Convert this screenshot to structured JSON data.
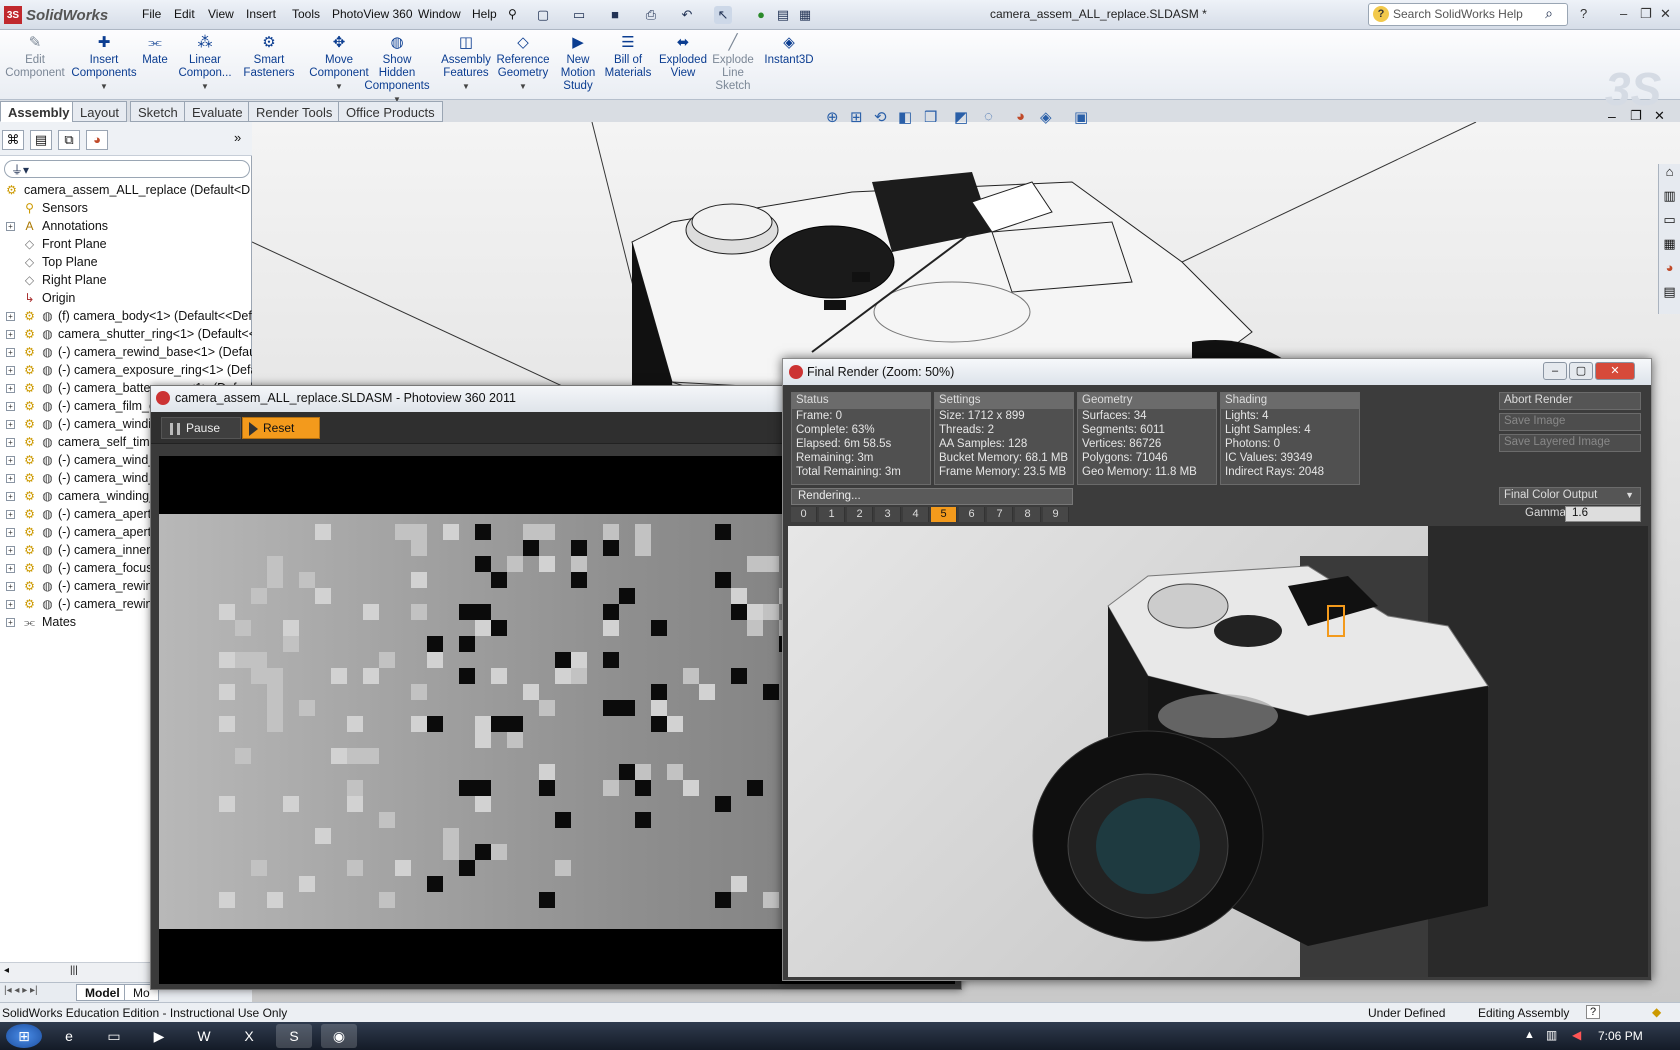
{
  "app": {
    "logo_text": "SolidWorks",
    "doc_title": "camera_assem_ALL_replace.SLDASM *",
    "help_search_placeholder": "Search SolidWorks Help"
  },
  "menu": [
    "File",
    "Edit",
    "View",
    "Insert",
    "Tools",
    "PhotoView 360",
    "Window",
    "Help"
  ],
  "commands": [
    {
      "label": "Edit\nComponent",
      "icon": "edit-component-icon",
      "disabled": true
    },
    {
      "label": "Insert\nComponents",
      "icon": "insert-components-icon"
    },
    {
      "label": "Mate",
      "icon": "mate-icon"
    },
    {
      "label": "Linear\nCompon...",
      "icon": "linear-pattern-icon"
    },
    {
      "label": "Smart\nFasteners",
      "icon": "smart-fasteners-icon"
    },
    {
      "label": "Move\nComponent",
      "icon": "move-component-icon"
    },
    {
      "label": "Show\nHidden\nComponents",
      "icon": "show-hidden-icon"
    },
    {
      "label": "Assembly\nFeatures",
      "icon": "assembly-features-icon"
    },
    {
      "label": "Reference\nGeometry",
      "icon": "reference-geometry-icon"
    },
    {
      "label": "New\nMotion\nStudy",
      "icon": "motion-study-icon"
    },
    {
      "label": "Bill of\nMaterials",
      "icon": "bom-icon"
    },
    {
      "label": "Exploded\nView",
      "icon": "exploded-view-icon"
    },
    {
      "label": "Explode\nLine\nSketch",
      "icon": "explode-line-icon",
      "disabled": true
    },
    {
      "label": "Instant3D",
      "icon": "instant3d-icon"
    }
  ],
  "tabs": [
    "Assembly",
    "Layout",
    "Sketch",
    "Evaluate",
    "Render Tools",
    "Office Products"
  ],
  "tree": [
    {
      "label": "camera_assem_ALL_replace  (Default<D",
      "icon": "assembly-icon",
      "level": 0
    },
    {
      "label": "Sensors",
      "icon": "sensors-icon",
      "level": 1
    },
    {
      "label": "Annotations",
      "icon": "annotations-icon",
      "level": 1,
      "expand": true
    },
    {
      "label": "Front Plane",
      "icon": "plane-icon",
      "level": 1
    },
    {
      "label": "Top Plane",
      "icon": "plane-icon",
      "level": 1
    },
    {
      "label": "Right Plane",
      "icon": "plane-icon",
      "level": 1
    },
    {
      "label": "Origin",
      "icon": "origin-icon",
      "level": 1
    },
    {
      "label": "(f) camera_body<1> (Default<<Defa",
      "icon": "part-icon",
      "level": 1,
      "expand": true
    },
    {
      "label": "camera_shutter_ring<1> (Default<<",
      "icon": "part-icon",
      "level": 1,
      "expand": true
    },
    {
      "label": "(-) camera_rewind_base<1> (Default",
      "icon": "part-icon",
      "level": 1,
      "expand": true
    },
    {
      "label": "(-) camera_exposure_ring<1> (Defau",
      "icon": "part-icon",
      "level": 1,
      "expand": true
    },
    {
      "label": "(-) camera_battery_cap<1> (Default",
      "icon": "part-icon",
      "level": 1,
      "expand": true
    },
    {
      "label": "(-) camera_film_c",
      "icon": "part-icon",
      "level": 1,
      "expand": true
    },
    {
      "label": "(-) camera_windi",
      "icon": "part-icon",
      "level": 1,
      "expand": true
    },
    {
      "label": "camera_self_time",
      "icon": "part-icon",
      "level": 1,
      "expand": true
    },
    {
      "label": "(-) camera_wind_",
      "icon": "part-icon",
      "level": 1,
      "expand": true
    },
    {
      "label": "(-) camera_wind_",
      "icon": "part-icon",
      "level": 1,
      "expand": true
    },
    {
      "label": "camera_winding_",
      "icon": "part-icon",
      "level": 1,
      "expand": true
    },
    {
      "label": "(-) camera_apert",
      "icon": "part-icon",
      "level": 1,
      "expand": true
    },
    {
      "label": "(-) camera_apert",
      "icon": "part-icon",
      "level": 1,
      "expand": true
    },
    {
      "label": "(-) camera_inner_",
      "icon": "part-icon",
      "level": 1,
      "expand": true
    },
    {
      "label": "(-) camera_focus_",
      "icon": "part-icon",
      "level": 1,
      "expand": true
    },
    {
      "label": "(-) camera_rewin",
      "icon": "part-icon",
      "level": 1,
      "expand": true
    },
    {
      "label": "(-) camera_rewin",
      "icon": "part-icon",
      "level": 1,
      "expand": true
    },
    {
      "label": "Mates",
      "icon": "mates-icon",
      "level": 1,
      "expand": true
    }
  ],
  "bottom_tabs": [
    "Model",
    "Mo"
  ],
  "photoview": {
    "title": "camera_assem_ALL_replace.SLDASM - Photoview 360 2011",
    "pause_label": "Pause",
    "reset_label": "Reset"
  },
  "final_render": {
    "title": "Final Render (Zoom: 50%)",
    "status": {
      "header": "Status",
      "lines": [
        "Frame: 0",
        "Complete: 63%",
        "Elapsed: 6m 58.5s",
        "Remaining: 3m",
        "Total Remaining: 3m"
      ]
    },
    "settings": {
      "header": "Settings",
      "lines": [
        "Size: 1712 x 899",
        "Threads: 2",
        "AA Samples: 128",
        "Bucket Memory: 68.1 MB",
        "Frame Memory: 23.5 MB"
      ]
    },
    "geometry": {
      "header": "Geometry",
      "lines": [
        "Surfaces: 34",
        "Segments: 6011",
        "Vertices: 86726",
        "Polygons: 71046",
        "Geo Memory: 11.8 MB"
      ]
    },
    "shading": {
      "header": "Shading",
      "lines": [
        "Lights: 4",
        "Light Samples: 4",
        "Photons: 0",
        "IC Values: 39349",
        "Indirect Rays: 2048"
      ]
    },
    "abort_label": "Abort Render",
    "save_image_label": "Save Image",
    "save_layered_label": "Save Layered Image",
    "output_label": "Final Color Output",
    "progress_text": "Rendering...",
    "buffers": [
      "0",
      "1",
      "2",
      "3",
      "4",
      "5",
      "6",
      "7",
      "8",
      "9"
    ],
    "active_buffer": 5,
    "gamma_label": "Gamma",
    "gamma_value": "1.6"
  },
  "statusbar": {
    "left": "SolidWorks Education Edition - Instructional Use Only",
    "state": "Under Defined",
    "mode": "Editing Assembly"
  },
  "taskbar": {
    "clock": "7:06 PM",
    "apps": [
      "start-orb-icon",
      "internet-explorer-icon",
      "file-explorer-icon",
      "media-player-icon",
      "word-icon",
      "excel-icon",
      "solidworks-icon",
      "photoview-icon"
    ]
  }
}
